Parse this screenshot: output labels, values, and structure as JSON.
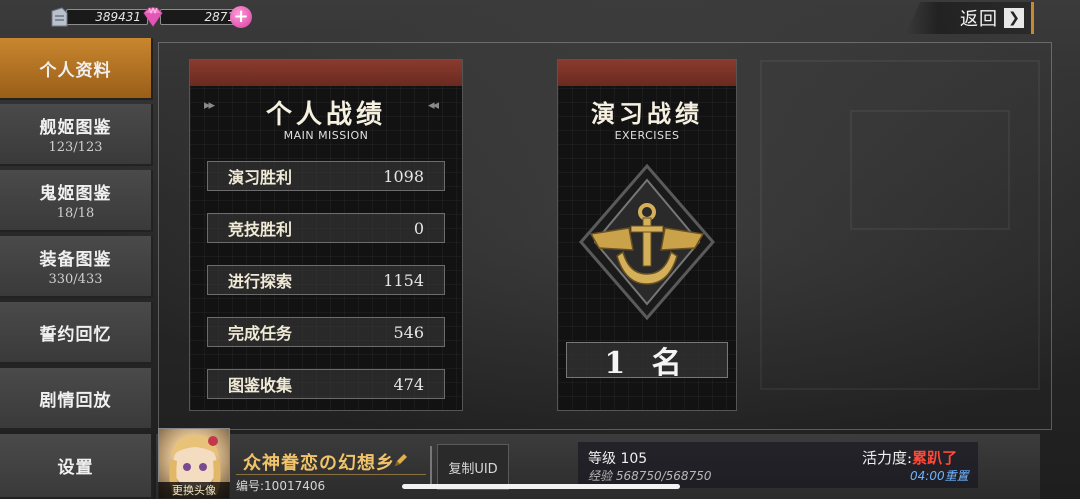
{
  "resources": {
    "fuel": "389431",
    "gems": "2871",
    "fuel_icon": "fuel-canister-icon",
    "gem_icon": "diamond-icon",
    "add_icon": "plus-icon"
  },
  "nav": {
    "back_label": "返回",
    "back_icon": "chevron-right-icon"
  },
  "sidebar": {
    "items": [
      {
        "label": "个人资料",
        "count": "",
        "active": true
      },
      {
        "label": "舰姬图鉴",
        "count": "123/123"
      },
      {
        "label": "鬼姬图鉴",
        "count": "18/18"
      },
      {
        "label": "装备图鉴",
        "count": "330/433"
      },
      {
        "label": "誓约回忆",
        "count": ""
      },
      {
        "label": "剧情回放",
        "count": ""
      },
      {
        "label": "设置",
        "count": ""
      }
    ]
  },
  "personal_record": {
    "title": "个人战绩",
    "subtitle": "MAIN MISSION",
    "stats": [
      {
        "label": "演习胜利",
        "value": "1098"
      },
      {
        "label": "竞技胜利",
        "value": "0"
      },
      {
        "label": "进行探索",
        "value": "1154"
      },
      {
        "label": "完成任务",
        "value": "546"
      },
      {
        "label": "图鉴收集",
        "value": "474"
      }
    ]
  },
  "exercise_record": {
    "title": "演习战绩",
    "subtitle": "EXERCISES",
    "emblem": "anchor-wings-emblem-icon",
    "rank": "1 名"
  },
  "profile": {
    "avatar_label": "更换头像",
    "name": "众神眷恋の幻想乡",
    "uid": "编号:10017406",
    "copy_uid": "复制UID",
    "level": "等级 105",
    "exp": "经验 568750/568750",
    "vitality_label": "活力度:",
    "vitality_state": "累趴了",
    "reset": "04:00重置"
  },
  "colors": {
    "accent": "#c8862e",
    "panel_header": "#7a3226",
    "warning": "#ff4a3a",
    "reset_blue": "#6fb4ff"
  }
}
